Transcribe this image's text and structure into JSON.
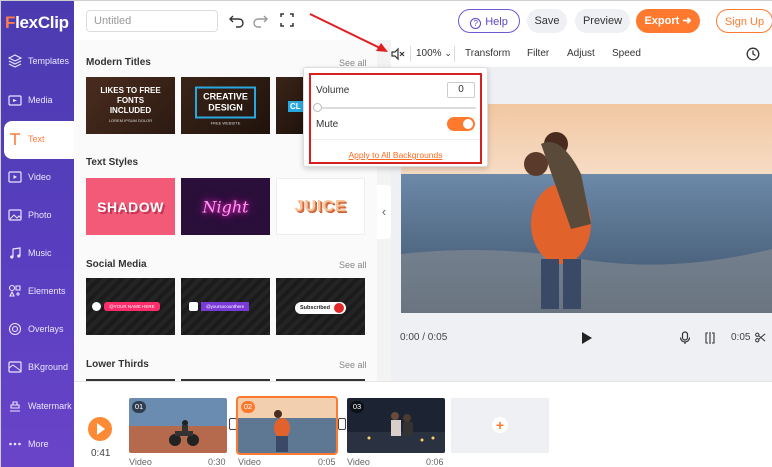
{
  "app": {
    "logo_f": "F",
    "logo_rest": "lexClip"
  },
  "sidebar": {
    "items": [
      {
        "label": "Templates",
        "icon": "layers-icon"
      },
      {
        "label": "Media",
        "icon": "folder-icon"
      },
      {
        "label": "Text",
        "icon": "text-icon"
      },
      {
        "label": "Video",
        "icon": "video-icon"
      },
      {
        "label": "Photo",
        "icon": "photo-icon"
      },
      {
        "label": "Music",
        "icon": "music-icon"
      },
      {
        "label": "Elements",
        "icon": "elements-icon"
      },
      {
        "label": "Overlays",
        "icon": "overlays-icon"
      },
      {
        "label": "BKground",
        "icon": "background-icon"
      },
      {
        "label": "Watermark",
        "icon": "watermark-icon"
      },
      {
        "label": "More",
        "icon": "more-icon"
      }
    ],
    "active": "Text"
  },
  "topbar": {
    "title_placeholder": "Untitled",
    "help": "Help",
    "save": "Save",
    "preview": "Preview",
    "export": "Export",
    "signup": "Sign Up"
  },
  "panel": {
    "sections": [
      {
        "title": "Modern Titles",
        "see_all": "See all",
        "thumbs": [
          "LIKES TO FREE FONTS INCLUDED",
          "CREATIVE DESIGN",
          "CL"
        ]
      },
      {
        "title": "Text Styles",
        "see_all": "",
        "thumbs": [
          "SHADOW",
          "Night",
          "JUICE"
        ]
      },
      {
        "title": "Social Media",
        "see_all": "See all",
        "thumbs": [
          "@YOUR NAME HERE",
          "@yoursocounthere",
          "Subscribed"
        ]
      },
      {
        "title": "Lower Thirds",
        "see_all": "See all"
      }
    ],
    "thumb_subtexts": [
      "LOREM IPSUM DOLOR",
      "FREE WEBSITE"
    ]
  },
  "toolbar": {
    "zoom": "100%",
    "transform": "Transform",
    "filter": "Filter",
    "adjust": "Adjust",
    "speed": "Speed"
  },
  "popup": {
    "volume_label": "Volume",
    "volume_value": "0",
    "volume_level": 0,
    "mute_label": "Mute",
    "mute_on": true,
    "apply_label": "Apply to All Backgrounds"
  },
  "player": {
    "time": "0:00 / 0:05",
    "right_time": "0:05"
  },
  "timeline": {
    "total": "0:41",
    "clips": [
      {
        "num": "01",
        "label": "Video",
        "time": "0:30"
      },
      {
        "num": "02",
        "label": "Video",
        "time": "0:05"
      },
      {
        "num": "03",
        "label": "Video",
        "time": "0:06"
      }
    ],
    "add": "+"
  },
  "colors": {
    "accent": "#ff7a2f",
    "sidebar": "#4f3db5",
    "highlight": "#d62020"
  }
}
